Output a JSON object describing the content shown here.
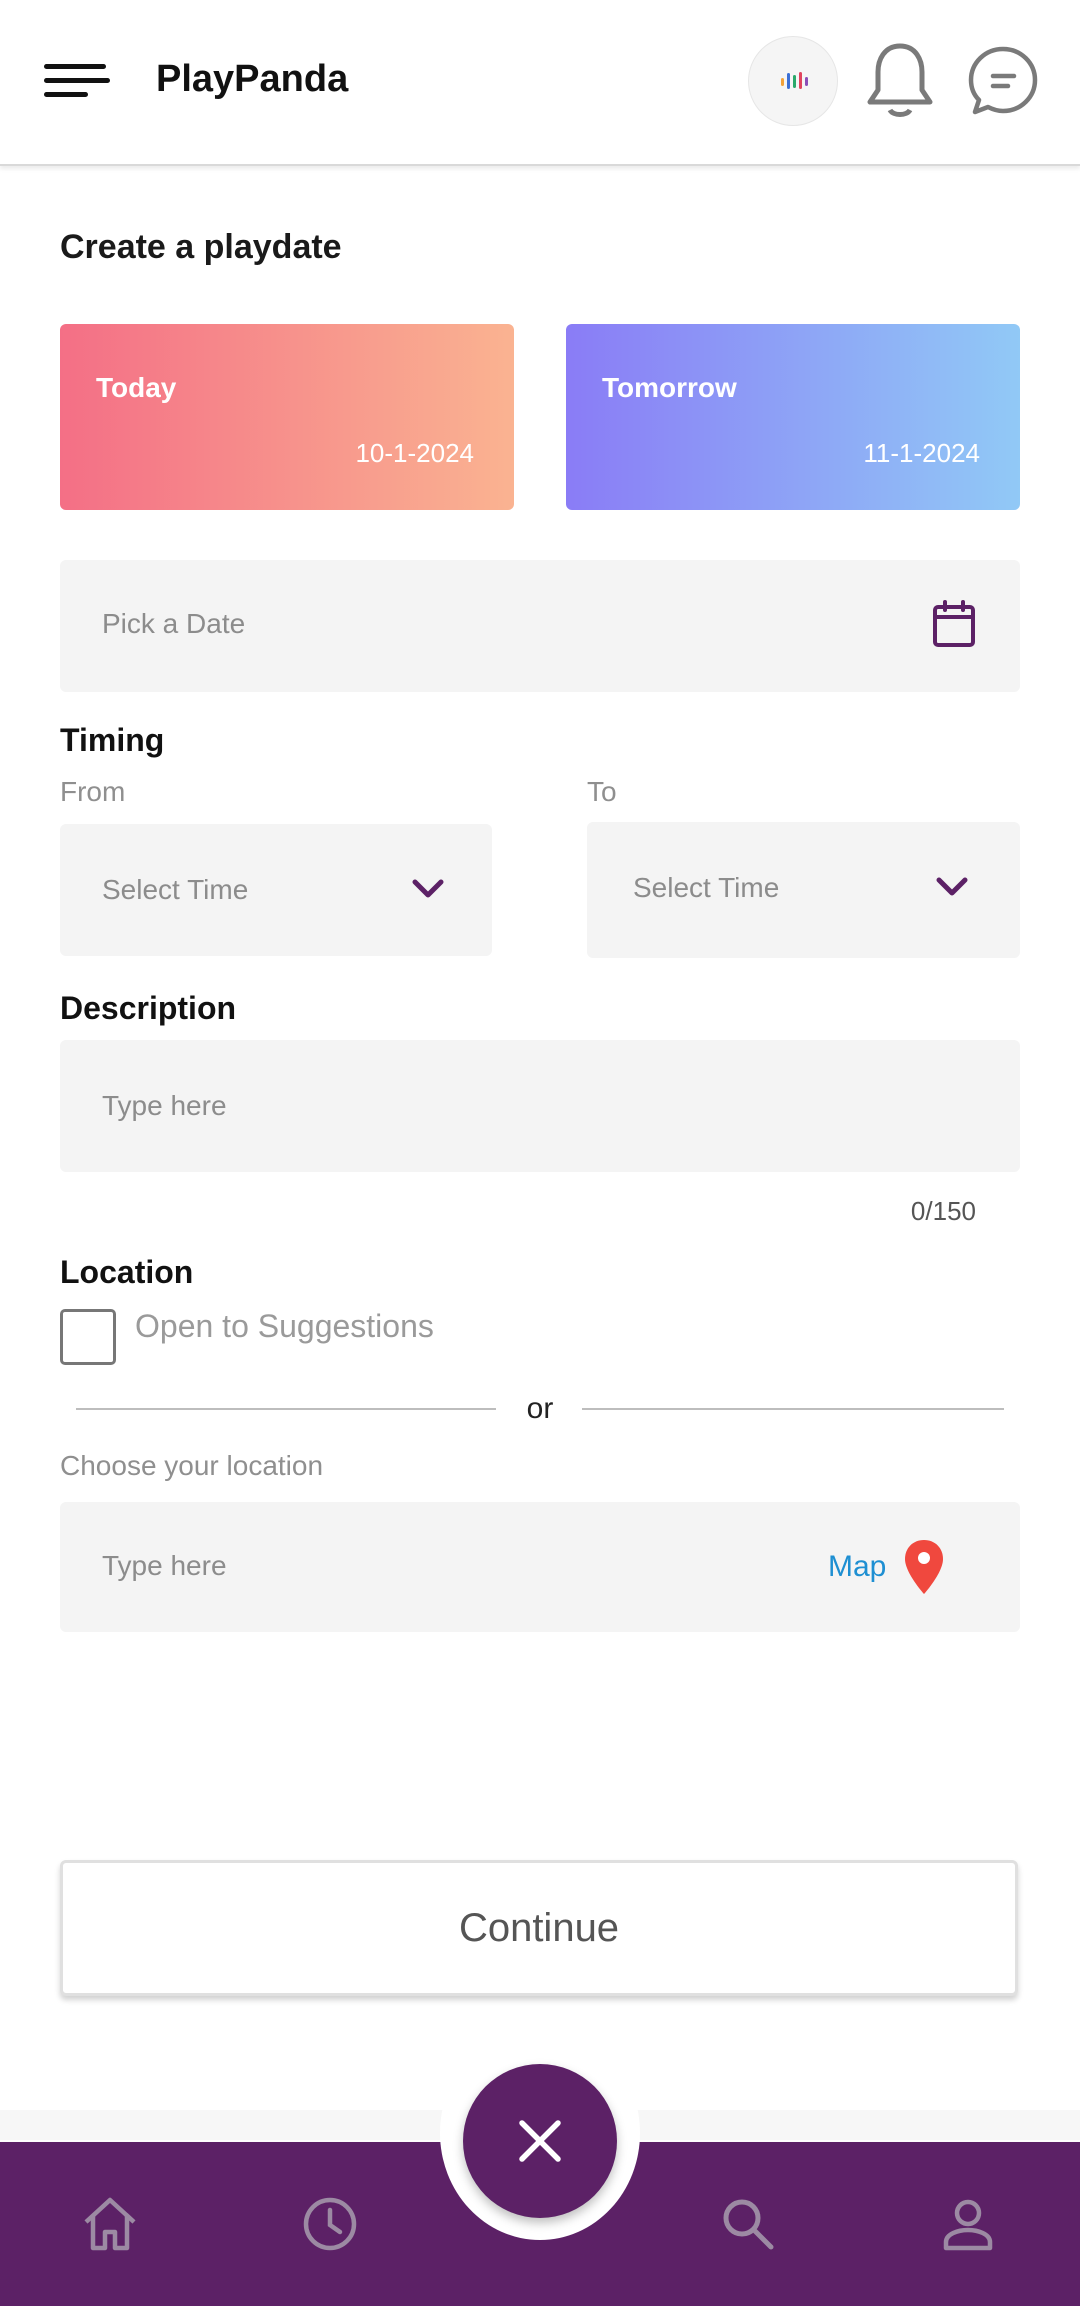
{
  "header": {
    "title": "PlayPanda",
    "icons": [
      "menu-icon",
      "logo-icon",
      "bell-icon",
      "chat-icon"
    ]
  },
  "page": {
    "title": "Create a playdate"
  },
  "quick_dates": [
    {
      "label": "Today",
      "date": "10-1-2024"
    },
    {
      "label": "Tomorrow",
      "date": "11-1-2024"
    }
  ],
  "date_picker": {
    "placeholder": "Pick a Date"
  },
  "timing": {
    "label": "Timing",
    "from_label": "From",
    "to_label": "To",
    "from_placeholder": "Select Time",
    "to_placeholder": "Select Time"
  },
  "description": {
    "label": "Description",
    "placeholder": "Type here",
    "counter": "0/150"
  },
  "location": {
    "label": "Location",
    "suggestions_label": "Open to Suggestions",
    "or_text": "or",
    "choose_label": "Choose your location",
    "placeholder": "Type here",
    "map_label": "Map"
  },
  "actions": {
    "continue_label": "Continue"
  },
  "bottom_nav": {
    "items": [
      "home-icon",
      "history-icon",
      "search-icon",
      "profile-icon"
    ],
    "center": "close-icon"
  },
  "colors": {
    "accent": "#5c2166",
    "today_gradient": [
      "#f46f86",
      "#fab391"
    ],
    "tomorrow_gradient": [
      "#8a7cf6",
      "#91c9f6"
    ],
    "map_link": "#1e8fd2",
    "pin": "#f0483e"
  }
}
